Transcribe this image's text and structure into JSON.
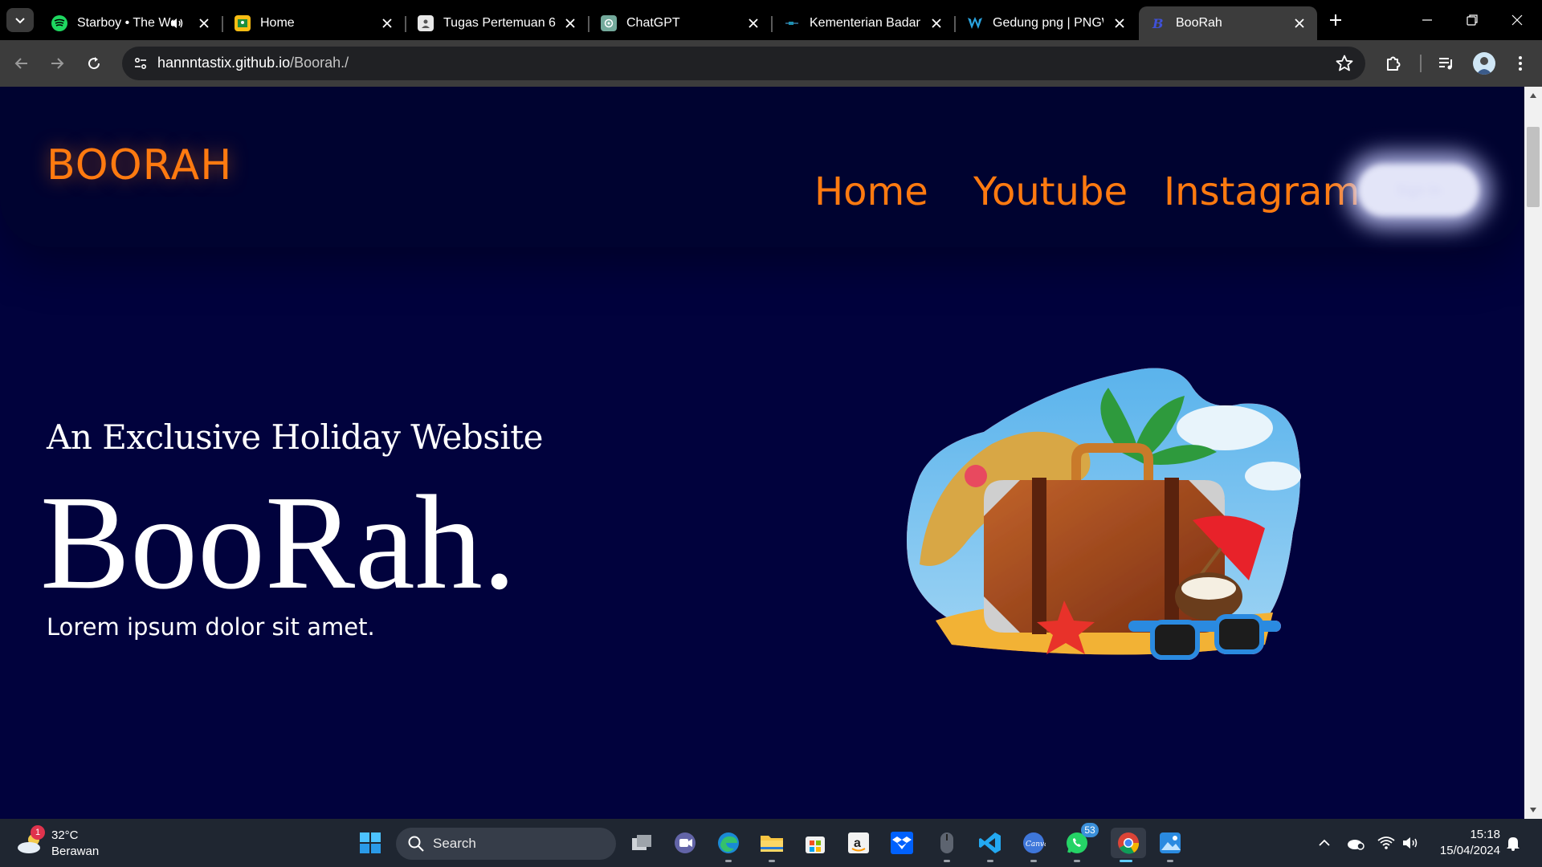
{
  "browser": {
    "tabs": [
      {
        "title": "Starboy • The We",
        "icon": "spotify-icon",
        "audio": true,
        "active": false
      },
      {
        "title": "Home",
        "icon": "google-classroom-icon",
        "active": false
      },
      {
        "title": "Tugas Pertemuan 6",
        "icon": "assignment-icon",
        "active": false
      },
      {
        "title": "ChatGPT",
        "icon": "chatgpt-icon",
        "active": false
      },
      {
        "title": "Kementerian Badan U",
        "icon": "ministry-icon",
        "active": false
      },
      {
        "title": "Gedung png | PNGW",
        "icon": "pngwing-icon",
        "active": false
      },
      {
        "title": "BooRah",
        "icon": "boorah-favicon",
        "active": true
      }
    ],
    "address": {
      "host": "hannntastix.github.io",
      "path": "/Boorah./"
    }
  },
  "site": {
    "logo": "BOORAH",
    "nav": [
      "Home",
      "Youtube",
      "Instagram"
    ],
    "nav_button": "Sign In",
    "hero": {
      "subtitle": "An Exclusive Holiday Website",
      "title": "BooRah.",
      "text": "Lorem ipsum dolor sit amet."
    },
    "colors": {
      "accent": "#ff7a10",
      "background": "#01023d",
      "nav_background": "#000330"
    }
  },
  "taskbar": {
    "weather": {
      "temp": "32°C",
      "desc": "Berawan",
      "badge": "1"
    },
    "search_placeholder": "Search",
    "whatsapp_badge": "53",
    "clock": {
      "time": "15:18",
      "date": "15/04/2024"
    }
  }
}
